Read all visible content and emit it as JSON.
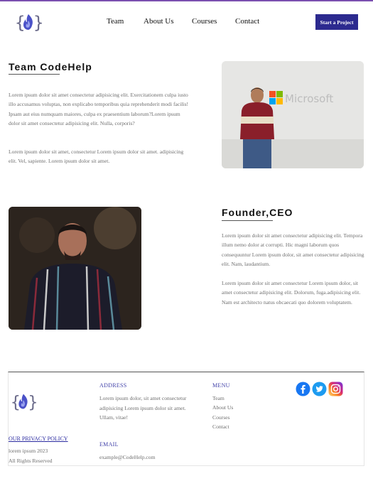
{
  "header": {
    "logo_icon": "codehelp-logo-icon",
    "nav": [
      "Team",
      "About Us",
      "Courses",
      "Contact"
    ],
    "cta": "Start a Project"
  },
  "team_section": {
    "title": "Team CodeHelp",
    "p1": "Lorem ipsum dolor sit amet consectetur adipisicing elit. Exercitationem culpa iusto illo accusamus voluptas, non explicabo temporibus quia reprehenderit modi facilis! Ipsam aut eius numquam maiores, culpa ex praesentium laborum?Lorem ipsum dolor sit amet consectetur adipisicing elit. Nulla, corporis?",
    "p2": "Lorem ipsum dolor sit amet, consectetur Lorem ipsum dolor sit amet. adipisicing elit. Vel, sapiente. Lorem ipsum dolor sit amet.",
    "photo_sign_text": "Microsoft"
  },
  "founder_section": {
    "title": "Founder,CEO",
    "p1": "Lorem ipsum dolor sit amet consectetur adipisicing elit. Tempora illum nemo dolor at corrupti. Hic magni laborum quos consequuntur Lorem ipsum dolor, sit amet consectetur adipisicing elit. Nam, laudantium.",
    "p2": "Lorem ipsum dolor sit amet consectetur Lorem ipsum dolor, sit amet consectetur adipisicing elit. Dolorum, fuga.adipisicing elit. Nam est architecto natus obcaecati quo dolorem voluptatem."
  },
  "footer": {
    "privacy": "OUR PRIVACY POLICY",
    "copyright": "lorem ipsum 2023",
    "rights": "All Rights Reserved",
    "address_title": "ADDRESS",
    "address_text": "Lorem ipsum dolor, sit amet consectetur adipisicing Lorem ipsum dolor sit amet. Ullam, vitae!",
    "email_title": "EMAIL",
    "email": "example@CodeHelp.com",
    "menu_title": "MENU",
    "menu": [
      "Team",
      "About Us",
      "Courses",
      "Contact"
    ],
    "social": [
      "facebook-icon",
      "twitter-icon",
      "instagram-icon"
    ]
  },
  "colors": {
    "accent": "#2c2a8f",
    "top_line": "#7b4fb0",
    "link_blue": "#3f3fa8"
  }
}
